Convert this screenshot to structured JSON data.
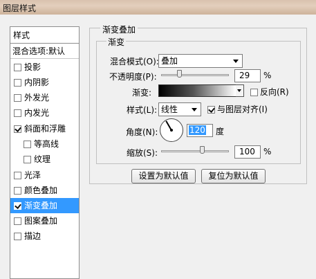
{
  "window": {
    "title": "图层样式"
  },
  "sidebar": {
    "header": "样式",
    "blend_options": "混合选项:默认",
    "items": [
      {
        "label": "投影",
        "checked": false
      },
      {
        "label": "内阴影",
        "checked": false
      },
      {
        "label": "外发光",
        "checked": false
      },
      {
        "label": "内发光",
        "checked": false
      },
      {
        "label": "斜面和浮雕",
        "checked": true
      },
      {
        "label": "等高线",
        "checked": false,
        "indent": true
      },
      {
        "label": "纹理",
        "checked": false,
        "indent": true
      },
      {
        "label": "光泽",
        "checked": false
      },
      {
        "label": "颜色叠加",
        "checked": false
      },
      {
        "label": "渐变叠加",
        "checked": true,
        "selected": true
      },
      {
        "label": "图案叠加",
        "checked": false
      },
      {
        "label": "描边",
        "checked": false
      }
    ]
  },
  "panel": {
    "title": "渐变叠加",
    "group_title": "渐变",
    "blend_mode_label": "混合模式(O):",
    "blend_mode_value": "叠加",
    "opacity_label": "不透明度(P):",
    "opacity_value": 29,
    "opacity_unit": "%",
    "gradient_label": "渐变:",
    "reverse_label": "反向(R)",
    "reverse_checked": false,
    "style_label": "样式(L):",
    "style_value": "线性",
    "align_label": "与图层对齐(I)",
    "align_checked": true,
    "angle_label": "角度(N):",
    "angle_value": "120",
    "angle_unit": "度",
    "scale_label": "缩放(S):",
    "scale_value": 100,
    "scale_unit": "%",
    "set_default_button": "设置为默认值",
    "reset_default_button": "复位为默认值"
  },
  "colors": {
    "selection": "#3399ff",
    "title_bar": "#d9c2ae"
  }
}
